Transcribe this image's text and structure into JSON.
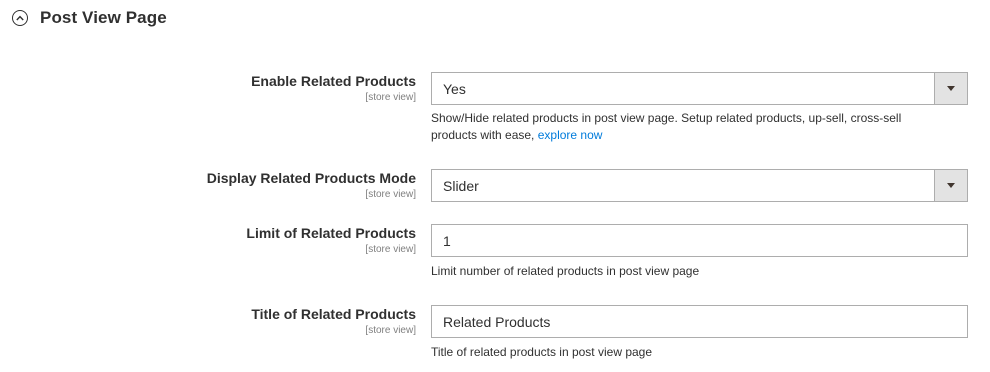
{
  "section": {
    "title": "Post View Page",
    "toggle_icon": "circle-chevron-up-icon"
  },
  "fields": [
    {
      "label": "Enable Related Products",
      "scope": "[store view]",
      "type": "select",
      "value": "Yes",
      "note_text": "Show/Hide related products in post view page. Setup related products, up-sell, cross-sell products with ease,",
      "note_link": "explore now"
    },
    {
      "label": "Display Related Products Mode",
      "scope": "[store view]",
      "type": "select",
      "value": "Slider"
    },
    {
      "label": "Limit of Related Products",
      "scope": "[store view]",
      "type": "text",
      "value": "1",
      "note_text": "Limit number of related products in post view page"
    },
    {
      "label": "Title of Related Products",
      "scope": "[store view]",
      "type": "text",
      "value": "Related Products",
      "note_text": "Title of related products in post view page"
    }
  ],
  "colors": {
    "link": "#007bdb",
    "text": "#303030",
    "scope": "#808080",
    "border": "#adadad",
    "select_arrow_bg": "#e3e3e3"
  }
}
